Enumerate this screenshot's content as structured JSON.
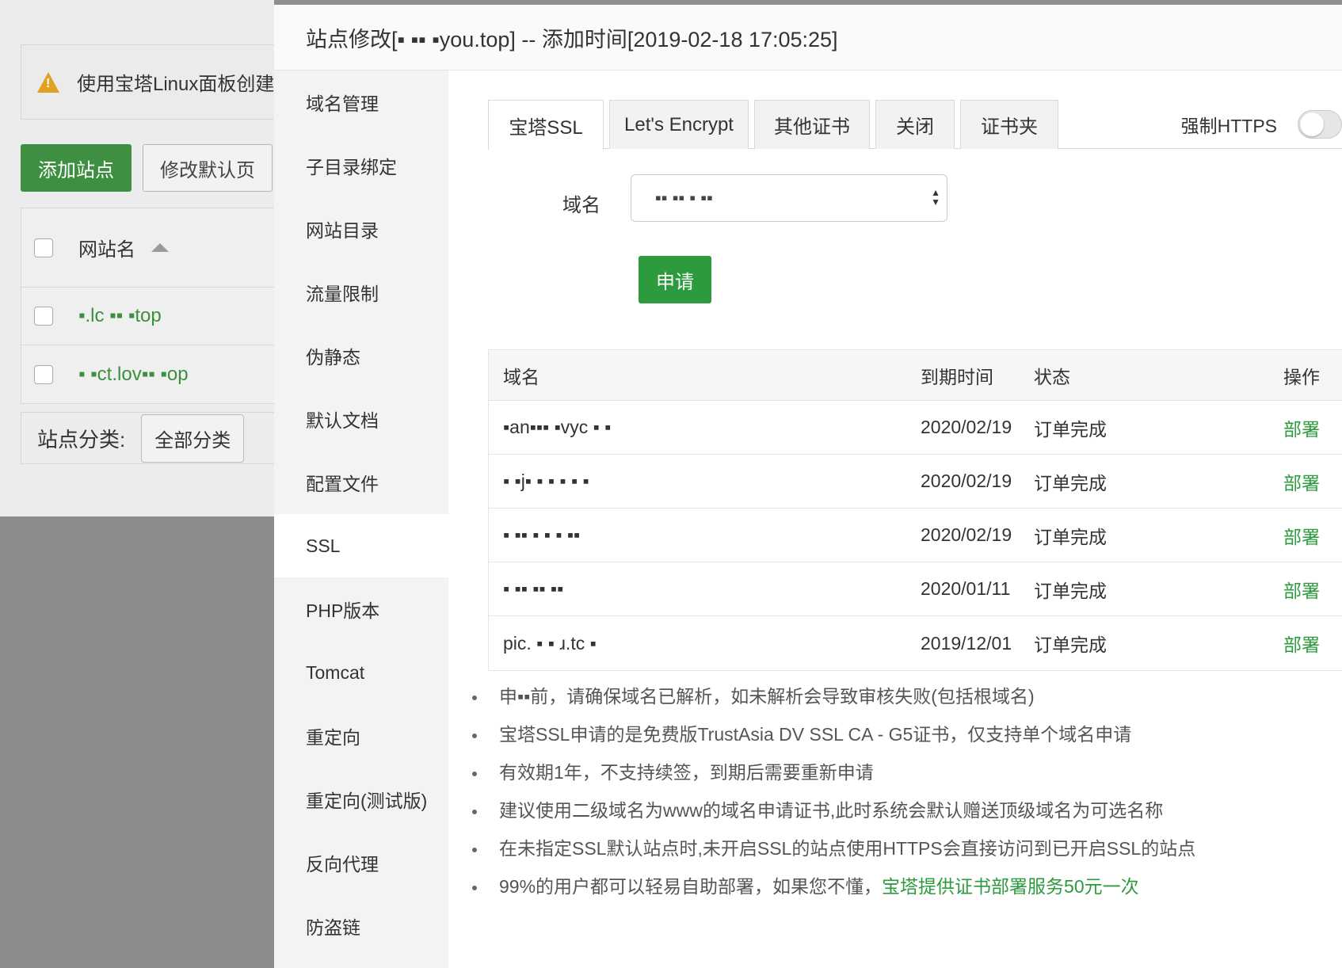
{
  "background": {
    "alert_text": "使用宝塔Linux面板创建",
    "add_site_label": "添加站点",
    "modify_default_label": "修改默认页",
    "sites_header": "网站名",
    "sites": [
      "▪.lc ▪▪ ▪top",
      "▪ ▪ct.lov▪▪ ▪op"
    ],
    "category_label": "站点分类:",
    "category_value": "全部分类"
  },
  "modal": {
    "title": "站点修改[▪ ▪▪ ▪you.top] -- 添加时间[2019-02-18 17:05:25]"
  },
  "menu": [
    "域名管理",
    "子目录绑定",
    "网站目录",
    "流量限制",
    "伪静态",
    "默认文档",
    "配置文件",
    "SSL",
    "PHP版本",
    "Tomcat",
    "重定向",
    "重定向(测试版)",
    "反向代理",
    "防盗链"
  ],
  "tabs": [
    "宝塔SSL",
    "Let's Encrypt",
    "其他证书",
    "关闭",
    "证书夹"
  ],
  "force_https_label": "强制HTTPS",
  "force_https_enabled": false,
  "domain_label": "域名",
  "domain_select_value": "▪▪ ▪▪ ▪ ▪▪",
  "apply_label": "申请",
  "table": {
    "headers": [
      "域名",
      "到期时间",
      "状态",
      "操作"
    ],
    "rows": [
      {
        "domain": "▪an▪▪▪ ▪vyc ▪ ▪",
        "expire": "2020/02/19",
        "status": "订单完成",
        "op": "部署"
      },
      {
        "domain": "▪ ▪j▪ ▪ ▪ ▪ ▪ ▪",
        "expire": "2020/02/19",
        "status": "订单完成",
        "op": "部署"
      },
      {
        "domain": "▪ ▪▪ ▪ ▪ ▪ ▪▪",
        "expire": "2020/02/19",
        "status": "订单完成",
        "op": "部署"
      },
      {
        "domain": "▪ ▪▪ ▪▪ ▪▪",
        "expire": "2020/01/11",
        "status": "订单完成",
        "op": "部署"
      },
      {
        "domain": "pic. ▪ ▪ ɹ.tc ▪",
        "expire": "2019/12/01",
        "status": "订单完成",
        "op": "部署"
      }
    ]
  },
  "notes": [
    "申▪▪前，请确保域名已解析，如未解析会导致审核失败(包括根域名)",
    "宝塔SSL申请的是免费版TrustAsia DV SSL CA - G5证书，仅支持单个域名申请",
    "有效期1年，不支持续签，到期后需要重新申请",
    "建议使用二级域名为www的域名申请证书,此时系统会默认赠送顶级域名为可选名称",
    "在未指定SSL默认站点时,未开启SSL的站点使用HTTPS会直接访问到已开启SSL的站点"
  ],
  "last_note": {
    "text": "99%的用户都可以轻易自助部署，如果您不懂，",
    "link": "宝塔提供证书部署服务50元一次"
  },
  "colors": {
    "accent": "#2e9a3e",
    "link": "#2e9a3e"
  }
}
